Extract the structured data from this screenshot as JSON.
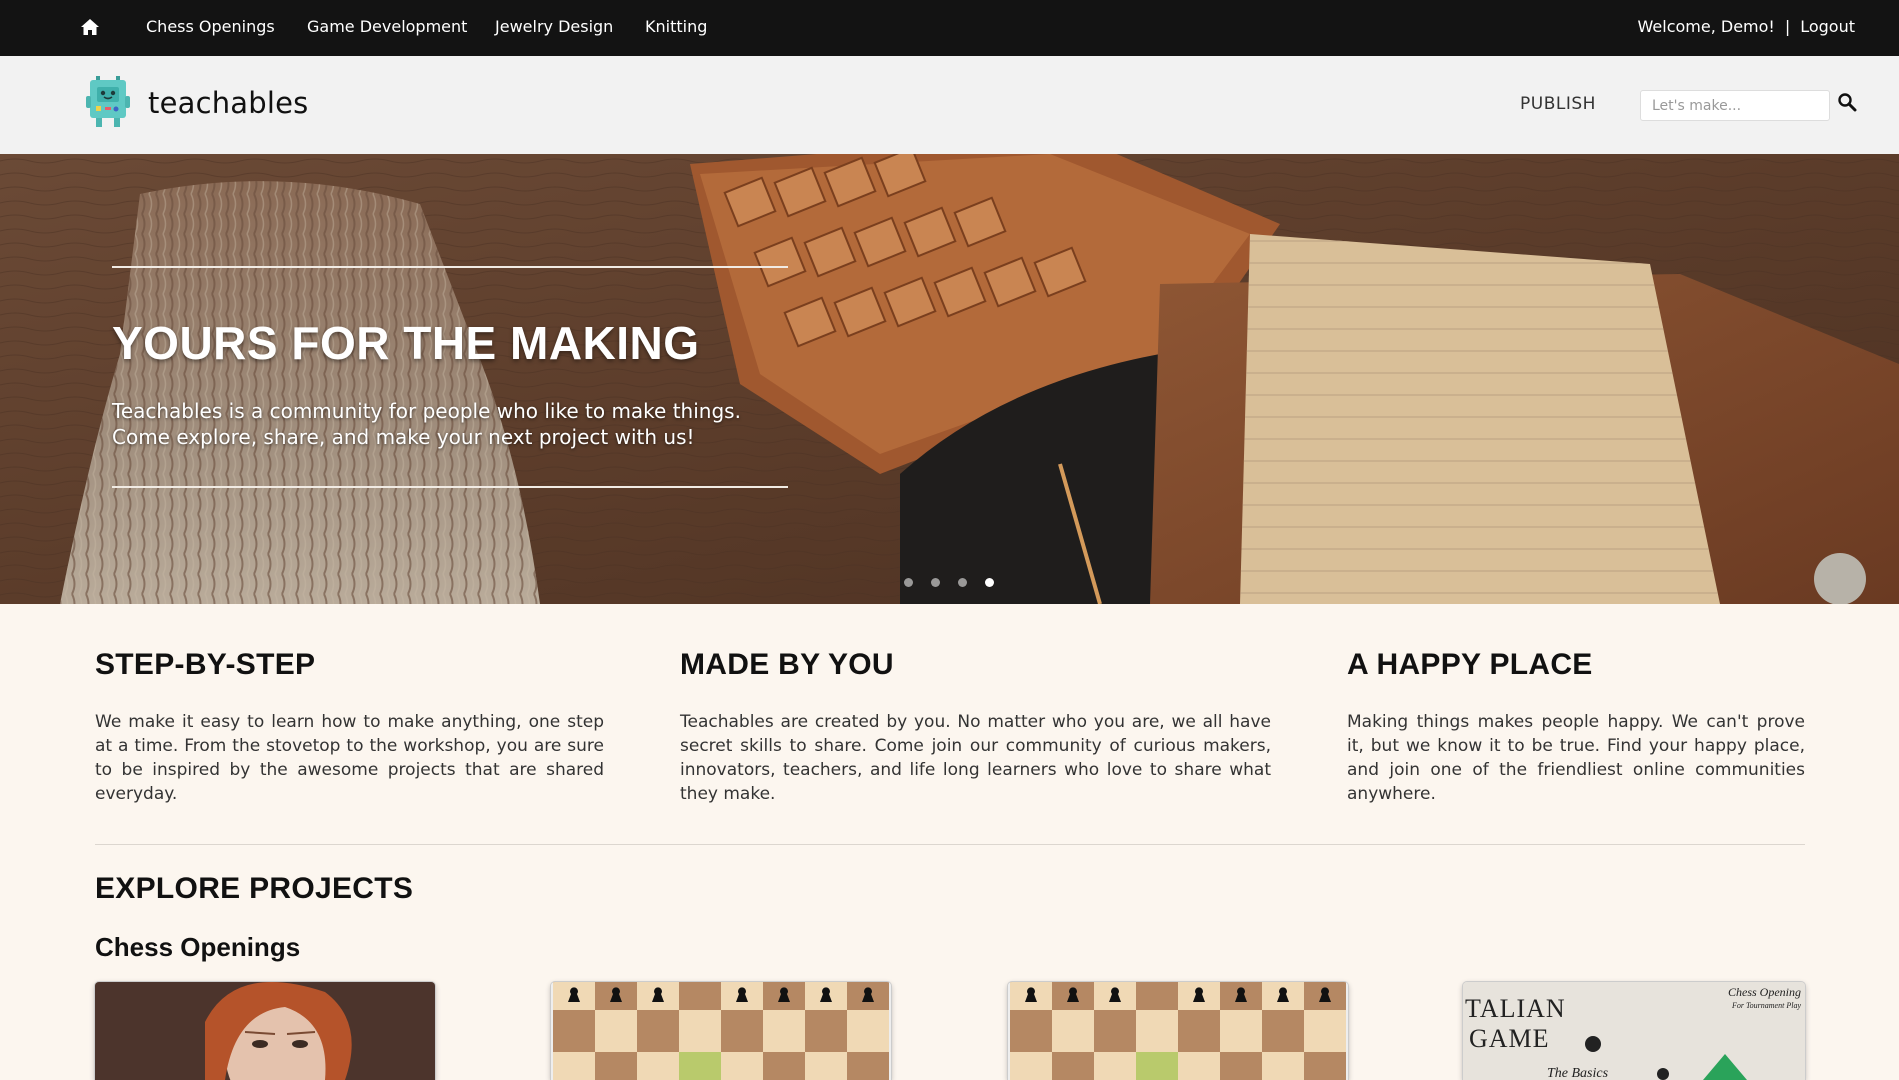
{
  "nav": {
    "links": [
      "Chess Openings",
      "Game Development",
      "Jewelry Design",
      "Knitting"
    ],
    "welcome": "Welcome, Demo!",
    "separator": "|",
    "logout": "Logout"
  },
  "brand": {
    "name": "teachables",
    "publish": "PUBLISH",
    "search_placeholder": "Let's make..."
  },
  "hero": {
    "title": "YOURS FOR THE MAKING",
    "text": "Teachables is a community for people who like to make things. Come explore, share, and make your next project with us!",
    "slides_count": 4,
    "active_slide": 4
  },
  "features": [
    {
      "title": "STEP-BY-STEP",
      "text": "We make it easy to learn how to make anything, one step at a time. From the stovetop to the workshop, you are sure to be inspired by the awesome projects that are shared everyday."
    },
    {
      "title": "MADE BY YOU",
      "text": "Teachables are created by you. No matter who you are, we all have secret skills to share. Come join our community of curious makers, innovators, teachers, and life long learners who love to share what they make."
    },
    {
      "title": "A HAPPY PLACE",
      "text": "Making things makes people happy. We can't prove it, but we know it to be true. Find your happy place, and join one of the friendliest online communities anywhere."
    }
  ],
  "explore": {
    "title": "EXPLORE PROJECTS",
    "category": "Chess Openings",
    "card4": {
      "title_line1": "TALIAN",
      "title_line2": "GAME",
      "subtitle": "The Basics",
      "corner_line1": "Chess Opening",
      "corner_line2": "For Tournament Play"
    }
  },
  "colors": {
    "topnav": "#131313",
    "brandbar": "#f2f2f2",
    "page_bg": "#fcf6ef",
    "logo": "#5fc9c4"
  }
}
